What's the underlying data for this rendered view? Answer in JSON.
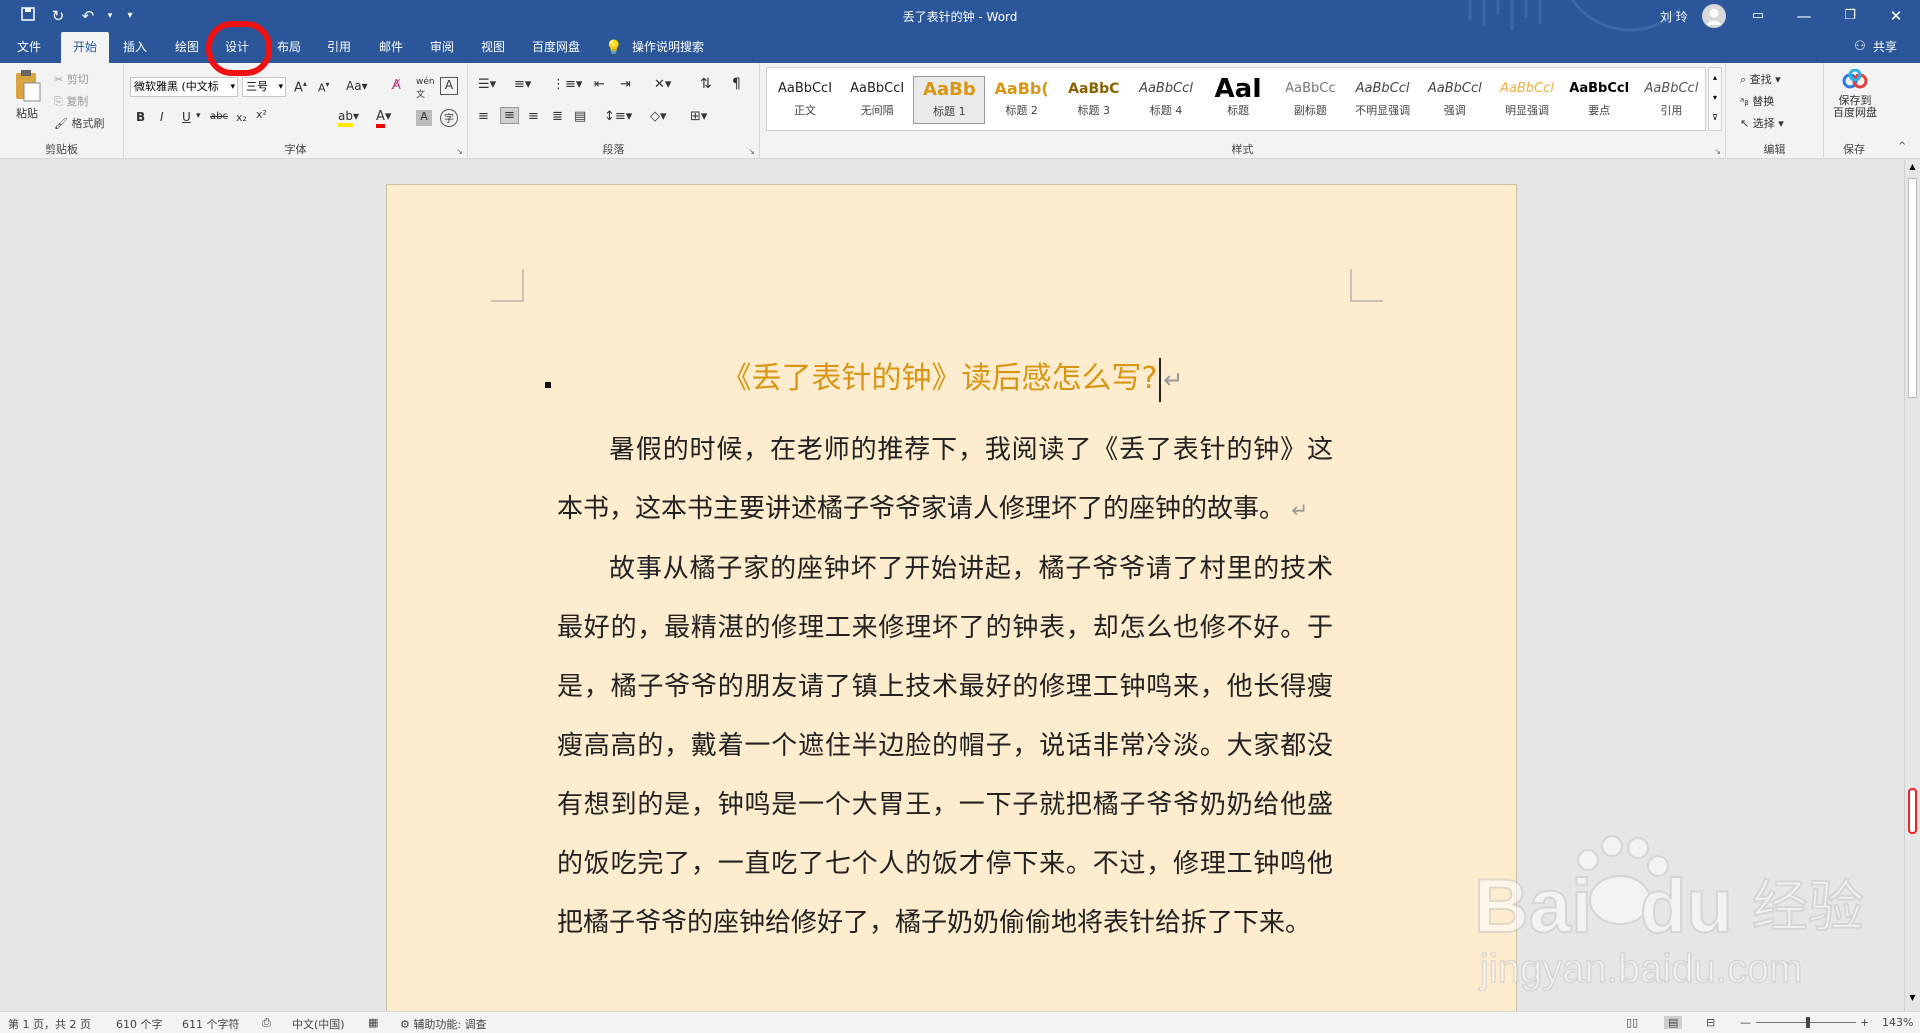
{
  "app": {
    "window_title": "丢了表针的钟 - Word",
    "user": "刘 玲"
  },
  "tabs": [
    "文件",
    "开始",
    "插入",
    "绘图",
    "设计",
    "布局",
    "引用",
    "邮件",
    "审阅",
    "视图",
    "百度网盘"
  ],
  "active_tab": "开始",
  "search_hint": "操作说明搜索",
  "share_label": "共享",
  "clipboard": {
    "paste": "粘贴",
    "cut": "剪切",
    "copy": "复制",
    "format_painter": "格式刷",
    "group": "剪贴板"
  },
  "font": {
    "family": "微软雅黑 (中文标",
    "size": "三号",
    "group": "字体"
  },
  "paragraph_group": "段落",
  "styles": {
    "group": "样式",
    "items": [
      {
        "preview": "AaBbCcI",
        "label": "正文"
      },
      {
        "preview": "AaBbCcI",
        "label": "无间隔"
      },
      {
        "preview": "AaBb",
        "label": "标题 1"
      },
      {
        "preview": "AaBb(",
        "label": "标题 2"
      },
      {
        "preview": "AaBbC",
        "label": "标题 3"
      },
      {
        "preview": "AaBbCcl",
        "label": "标题 4"
      },
      {
        "preview": "AaI",
        "label": "标题"
      },
      {
        "preview": "AaBbCc",
        "label": "副标题"
      },
      {
        "preview": "AaBbCcl",
        "label": "不明显强调"
      },
      {
        "preview": "AaBbCcl",
        "label": "强调"
      },
      {
        "preview": "AaBbCcl",
        "label": "明显强调"
      },
      {
        "preview": "AaBbCcl",
        "label": "要点"
      },
      {
        "preview": "AaBbCcl",
        "label": "引用"
      }
    ]
  },
  "editing": {
    "find": "查找",
    "replace": "替换",
    "select": "选择",
    "group": "编辑"
  },
  "save": {
    "label_line1": "保存到",
    "label_line2": "百度网盘",
    "group": "保存"
  },
  "document": {
    "title": "《丢了表针的钟》读后感怎么写?",
    "paragraphs": [
      "暑假的时候，在老师的推荐下，我阅读了《丢了表针的钟》这本书，这本书主要讲述橘子爷爷家请人修理坏了的座钟的故事。",
      "故事从橘子家的座钟坏了开始讲起，橘子爷爷请了村里的技术最好的，最精湛的修理工来修理坏了的钟表，却怎么也修不好。于是，橘子爷爷的朋友请了镇上技术最好的修理工钟鸣来，他长得瘦瘦高高的，戴着一个遮住半边脸的帽子，说话非常冷淡。大家都没有想到的是，钟鸣是一个大胃王，一下子就把橘子爷爷奶奶给他盛的饭吃完了，一直吃了七个人的饭才停下来。不过，修理工钟鸣他把橘子爷爷的座钟给修好了，橘子奶奶偷偷地将表针给拆了下来。"
    ]
  },
  "status": {
    "page": "第 1 页，共 2 页",
    "words": "610 个字",
    "chars": "611 个字符",
    "lang": "中文(中国)",
    "accessibility": "辅助功能: 调查",
    "zoom": "143%"
  },
  "watermark": {
    "text": "Baidu经验",
    "url": "jingyan.baidu.com"
  },
  "colors": {
    "brand": "#2b579a",
    "page_bg": "#fdeccd",
    "title": "#d89614",
    "annotation": "#ee1111"
  }
}
